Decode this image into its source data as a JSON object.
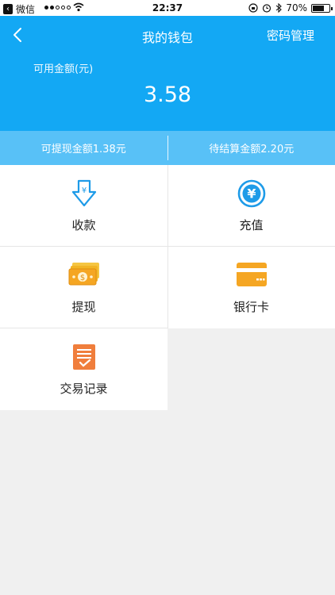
{
  "status_bar": {
    "back_app": "微信",
    "time": "22:37",
    "battery": "70%",
    "battery_level": 0.7
  },
  "header": {
    "title": "我的钱包",
    "action": "密码管理",
    "balance_label": "可用金额(元)",
    "balance": "3.58"
  },
  "summary": {
    "withdrawable": "可提现金额1.38元",
    "pending": "待结算金额2.20元"
  },
  "menu": [
    {
      "label": "收款",
      "icon": "receive-icon"
    },
    {
      "label": "充值",
      "icon": "yuan-circle-icon"
    },
    {
      "label": "提现",
      "icon": "cash-icon"
    },
    {
      "label": "银行卡",
      "icon": "bank-card-icon"
    },
    {
      "label": "交易记录",
      "icon": "record-icon"
    }
  ],
  "colors": {
    "header": "#13a8f4",
    "summary_bar": "#58c1f7",
    "icon_blue": "#1e9be8",
    "icon_orange": "#f5a623",
    "icon_red_orange": "#f07e3c"
  }
}
